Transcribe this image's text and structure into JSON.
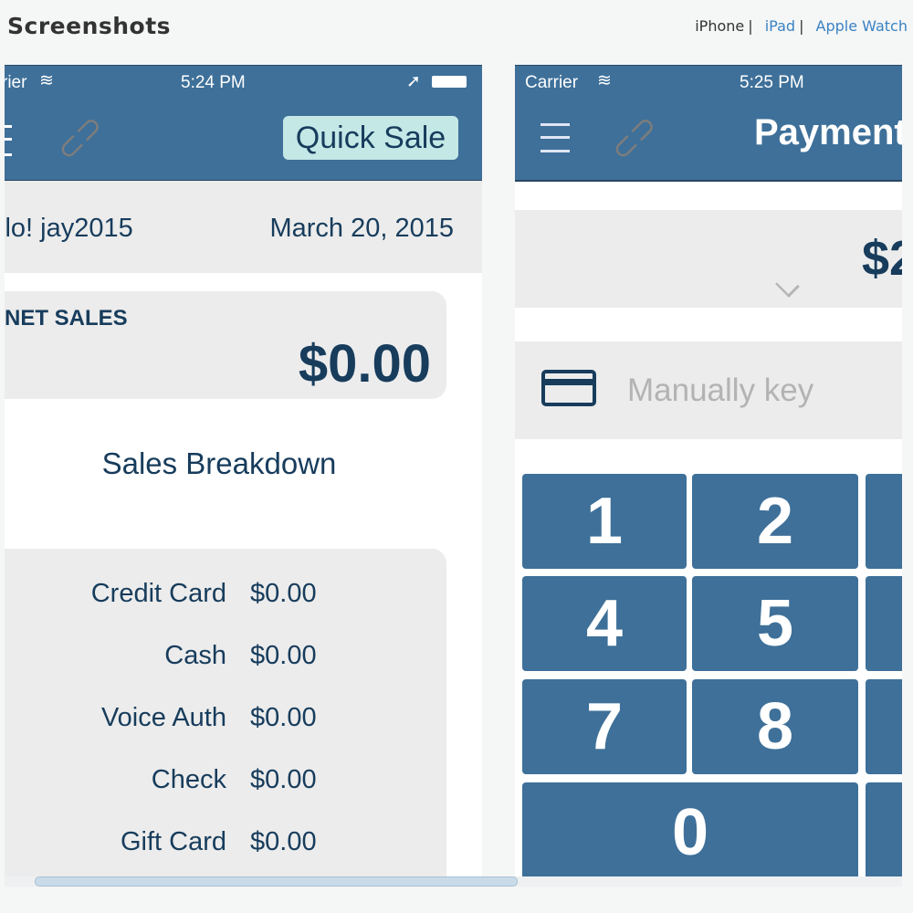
{
  "header": {
    "title": "Screenshots",
    "devices": [
      {
        "label": "iPhone",
        "active": true
      },
      {
        "label": "iPad",
        "active": false
      },
      {
        "label": "Apple Watch",
        "active": false
      }
    ],
    "separator": "|"
  },
  "screen1": {
    "carrier": "rier",
    "time": "5:24 PM",
    "quick_sale": "Quick Sale",
    "greeting": "llo! jay2015",
    "date": "March 20, 2015",
    "net_sales_label": "NET SALES",
    "net_sales_value": "$0.00",
    "breakdown_title": "Sales Breakdown",
    "breakdown": [
      {
        "label": "Credit Card",
        "value": "$0.00"
      },
      {
        "label": "Cash",
        "value": "$0.00"
      },
      {
        "label": "Voice Auth",
        "value": "$0.00"
      },
      {
        "label": "Check",
        "value": "$0.00"
      },
      {
        "label": "Gift Card",
        "value": "$0.00"
      }
    ]
  },
  "screen2": {
    "carrier": "Carrier",
    "time": "5:25 PM",
    "title": "Payment",
    "amount": "$2",
    "manual_key": "Manually key",
    "keys": [
      "1",
      "2",
      "4",
      "5",
      "7",
      "8",
      "0"
    ]
  },
  "colors": {
    "nav": "#3e7099",
    "quick_sale_bg": "#c4e8e6",
    "text_dark": "#173c5c",
    "link": "#3b83c4"
  }
}
